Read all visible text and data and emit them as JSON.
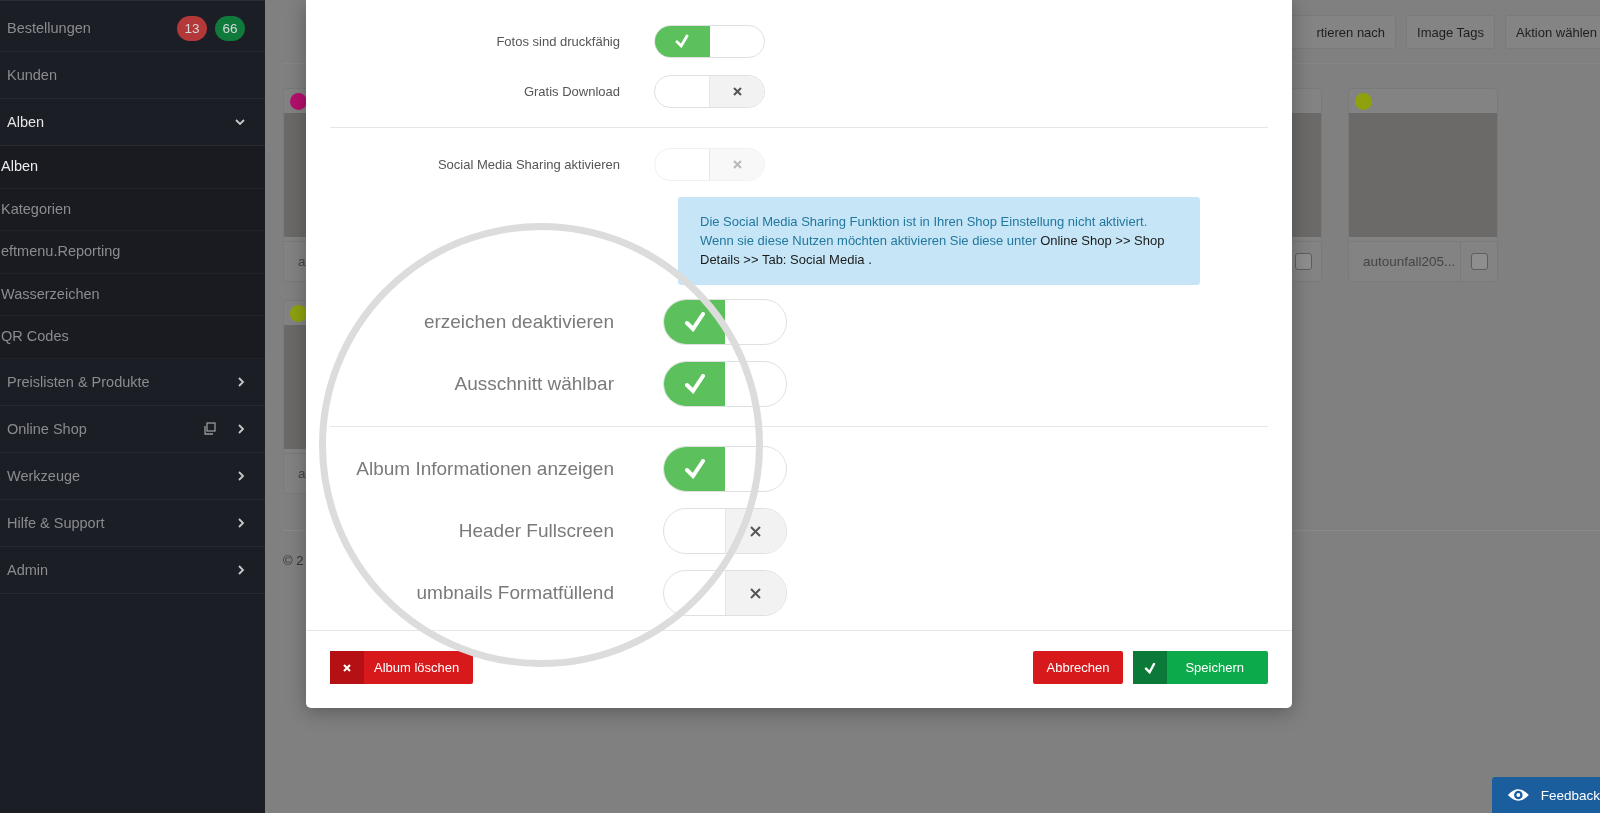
{
  "sidebar": {
    "items": [
      {
        "label": "Bestellungen",
        "kind": "link",
        "selected": false,
        "badges": [
          {
            "text": "13",
            "color": "#b2383a"
          },
          {
            "text": "66",
            "color": "#0f7a3c"
          }
        ]
      },
      {
        "label": "Kunden",
        "kind": "link",
        "selected": false
      },
      {
        "label": "Alben",
        "kind": "group",
        "selected": true,
        "expanded": true,
        "children": [
          {
            "label": "Alben",
            "selected": true
          },
          {
            "label": "Kategorien",
            "selected": false
          },
          {
            "label": "eftmenu.Reporting",
            "selected": false
          },
          {
            "label": "Wasserzeichen",
            "selected": false
          },
          {
            "label": "QR Codes",
            "selected": false
          }
        ]
      },
      {
        "label": "Preislisten & Produkte",
        "kind": "group",
        "selected": false,
        "expanded": false
      },
      {
        "label": "Online Shop",
        "kind": "group",
        "selected": false,
        "expanded": false,
        "new_window": true
      },
      {
        "label": "Werkzeuge",
        "kind": "group",
        "selected": false,
        "expanded": false
      },
      {
        "label": "Hilfe & Support",
        "kind": "group",
        "selected": false,
        "expanded": false
      },
      {
        "label": "Admin",
        "kind": "group",
        "selected": false,
        "expanded": false
      }
    ]
  },
  "toolbar": {
    "buttons": [
      "rtieren nach",
      "Image Tags",
      "Aktion wählen"
    ]
  },
  "gallery": {
    "rows": [
      {
        "left_cards": [
          {
            "caption": "a",
            "color": "#b3106c"
          }
        ],
        "right_cards": [
          {
            "checked": false
          },
          {
            "caption": "autounfall205...",
            "color": "#8fa20d",
            "checked": false
          }
        ]
      },
      {
        "left_cards": [
          {
            "caption": "a",
            "color": "#8fa20d"
          }
        ]
      }
    ]
  },
  "footer": {
    "text": "© 2"
  },
  "modal": {
    "sections": [
      {
        "rows": [
          {
            "label": "Fotos sind druckfähig",
            "on": true,
            "disabled": false,
            "zoomed": false
          },
          {
            "label": "Gratis Download",
            "on": false,
            "disabled": false,
            "zoomed": false
          }
        ]
      },
      {
        "rows": [
          {
            "label": "Social Media Sharing aktivieren",
            "on": false,
            "disabled": true,
            "zoomed": false
          }
        ],
        "notice": [
          {
            "kind": "plain",
            "text": "Die Social Media Sharing Funktion ist in Ihren Shop Einstellung nicht aktiviert. Wenn sie diese Nutzen möchten aktivieren Sie diese unter "
          },
          {
            "kind": "path",
            "text": "Online Shop >> Shop Details >> Tab: Social Media ."
          }
        ],
        "rows_after": [
          {
            "label": "erzeichen deaktivieren",
            "on": true,
            "disabled": false,
            "zoomed": true
          },
          {
            "label": "Ausschnitt wählbar",
            "on": true,
            "disabled": false,
            "zoomed": true
          }
        ]
      },
      {
        "rows": [
          {
            "label": "Album Informationen anzeigen",
            "on": true,
            "disabled": false,
            "zoomed": true
          },
          {
            "label": "Header Fullscreen",
            "on": false,
            "disabled": false,
            "zoomed": true
          },
          {
            "label": "umbnails Formatfüllend",
            "on": false,
            "disabled": false,
            "zoomed": true
          }
        ]
      }
    ],
    "delete_button": "Album löschen",
    "cancel_button": "Abbrechen",
    "save_button": "Speichern"
  },
  "feedback": {
    "label": "Feedback"
  }
}
